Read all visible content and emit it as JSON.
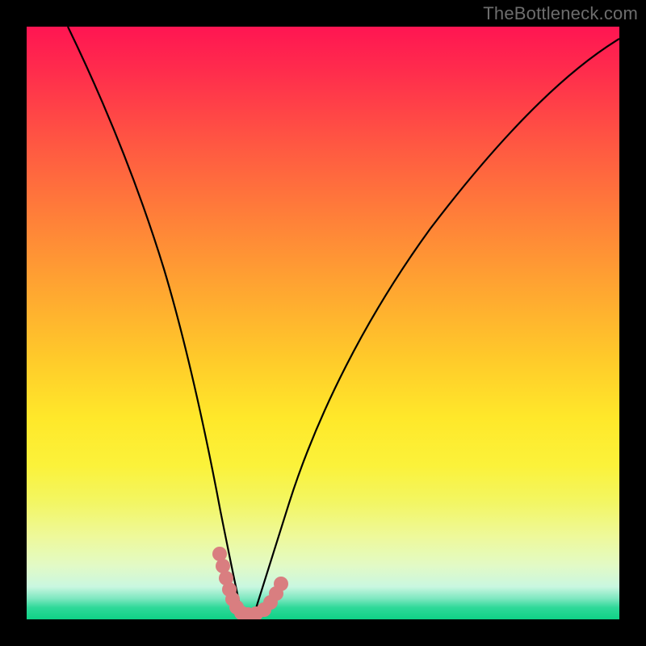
{
  "watermark": "TheBottleneck.com",
  "chart_data": {
    "type": "line",
    "title": "",
    "xlabel": "",
    "ylabel": "",
    "xlim": [
      0,
      100
    ],
    "ylim": [
      0,
      100
    ],
    "series": [
      {
        "name": "black-curve",
        "x": [
          7,
          10,
          14,
          18,
          22,
          25,
          28,
          30,
          32,
          33.5,
          35,
          36,
          37,
          38,
          40,
          43,
          47,
          52,
          58,
          65,
          73,
          82,
          92,
          100
        ],
        "y": [
          100,
          88,
          74,
          60,
          45,
          33,
          22,
          14,
          8,
          4,
          1,
          0,
          0,
          1,
          3,
          8,
          16,
          27,
          40,
          53,
          65,
          76,
          85,
          91
        ]
      },
      {
        "name": "pink-overlay",
        "x": [
          32,
          33,
          33.8,
          34.6,
          35.4,
          36.2,
          37.5,
          38.8,
          40,
          41,
          42
        ],
        "y": [
          8,
          5,
          3,
          1.5,
          0.6,
          0.2,
          0.1,
          0.3,
          1.2,
          3,
          6
        ]
      }
    ]
  },
  "colors": {
    "curve": "#000000",
    "overlay": "#d97e80",
    "background_top": "#ff1552",
    "background_bottom": "#0fd186",
    "frame": "#000000",
    "watermark": "#6d6d6d"
  }
}
